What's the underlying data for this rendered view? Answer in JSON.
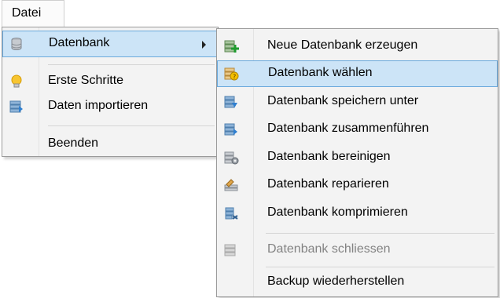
{
  "menubar": {
    "tab_label": "Datei"
  },
  "main_menu": {
    "items": [
      {
        "label": "Datenbank",
        "icon": "database-icon"
      },
      {
        "label": "Erste Schritte",
        "icon": "lightbulb-icon"
      },
      {
        "label": "Daten importieren",
        "icon": "import-icon"
      },
      {
        "label": "Beenden",
        "icon": ""
      }
    ]
  },
  "sub_menu": {
    "items": [
      {
        "label": "Neue Datenbank erzeugen",
        "icon": "add-database-icon"
      },
      {
        "label": "Datenbank wählen",
        "icon": "select-database-icon"
      },
      {
        "label": "Datenbank speichern unter",
        "icon": "save-database-icon"
      },
      {
        "label": "Datenbank zusammenführen",
        "icon": "merge-database-icon"
      },
      {
        "label": "Datenbank bereinigen",
        "icon": "cleanup-database-icon"
      },
      {
        "label": "Datenbank reparieren",
        "icon": "repair-database-icon"
      },
      {
        "label": "Datenbank komprimieren",
        "icon": "compress-database-icon"
      },
      {
        "label": "Datenbank schliessen",
        "icon": "close-database-icon"
      },
      {
        "label": "Backup wiederherstellen",
        "icon": ""
      }
    ]
  },
  "colors": {
    "highlight_bg": "#cce4f7",
    "highlight_border": "#6aa9dc",
    "menu_bg": "#f3f3f3"
  }
}
